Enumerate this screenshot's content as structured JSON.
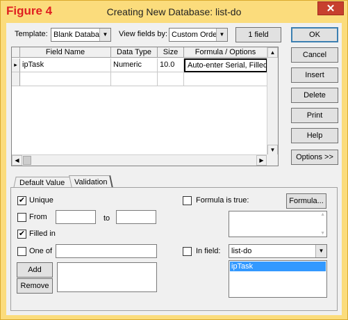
{
  "figure_label": "Figure 4",
  "window_title": "Creating New Database: list-do",
  "close_glyph": "✕",
  "toolbar": {
    "template_label": "Template:",
    "template_value": "Blank Databa",
    "view_fields_label": "View fields by:",
    "view_fields_value": "Custom Orde",
    "field_count": "1 field"
  },
  "table": {
    "columns": [
      "Field Name",
      "Data Type",
      "Size",
      "Formula / Options"
    ],
    "rows": [
      {
        "name": "ipTask",
        "type": "Numeric",
        "size": "10.0",
        "formula": "Auto-enter Serial, Filled In,"
      }
    ]
  },
  "side_buttons": {
    "ok": "OK",
    "cancel": "Cancel",
    "insert": "Insert",
    "delete": "Delete",
    "print": "Print",
    "help": "Help",
    "options": "Options >>"
  },
  "tabs": [
    "Default Value",
    "Validation"
  ],
  "validation": {
    "unique": {
      "label": "Unique",
      "checked": true
    },
    "from": {
      "label": "From",
      "checked": false,
      "from_value": "",
      "to_label": "to",
      "to_value": ""
    },
    "filled_in": {
      "label": "Filled in",
      "checked": true
    },
    "one_of": {
      "label": "One of",
      "checked": false,
      "value": ""
    },
    "add_button": "Add",
    "remove_button": "Remove",
    "formula_true": {
      "label": "Formula is true:",
      "checked": false,
      "button": "Formula..."
    },
    "in_field": {
      "label": "In field:",
      "checked": false,
      "db_value": "list-do",
      "list_items": [
        "ipTask"
      ]
    }
  },
  "glyphs": {
    "check": "✔",
    "arrow_down": "▼",
    "arrow_up": "▲",
    "arrow_left": "◀",
    "arrow_right": "▶",
    "row_marker": "▸"
  }
}
